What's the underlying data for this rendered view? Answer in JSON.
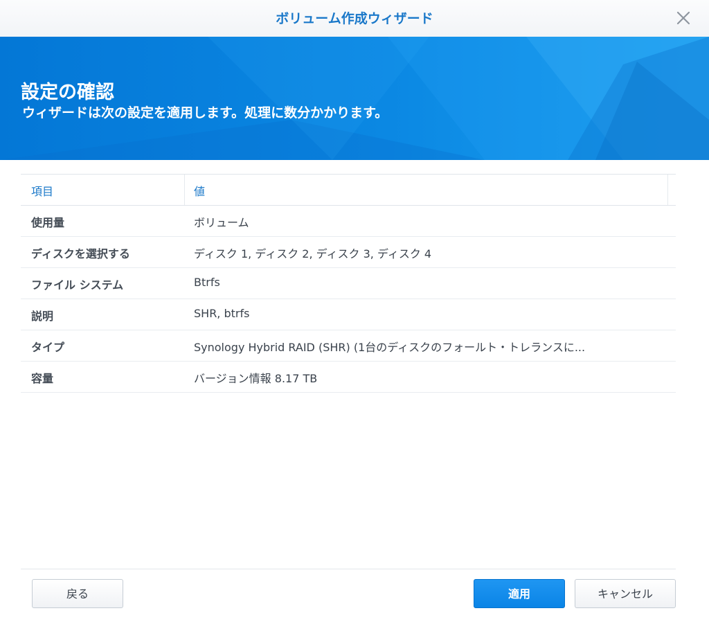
{
  "window": {
    "title": "ボリューム作成ウィザード"
  },
  "banner": {
    "title": "設定の確認",
    "subtitle": "ウィザードは次の設定を適用します。処理に数分かかります。"
  },
  "table": {
    "columns": [
      "項目",
      "値"
    ],
    "rows": [
      {
        "item": "使用量",
        "value": "ボリューム"
      },
      {
        "item": "ディスクを選択する",
        "value": "ディスク 1, ディスク 2, ディスク 3, ディスク 4"
      },
      {
        "item": "ファイル システム",
        "value": "Btrfs"
      },
      {
        "item": "説明",
        "value": "SHR, btrfs"
      },
      {
        "item": "タイプ",
        "value": "Synology Hybrid RAID (SHR) (1台のディスクのフォールト・トレランスに..."
      },
      {
        "item": "容量",
        "value": "バージョン情報 8.17 TB"
      }
    ]
  },
  "footer": {
    "back_label": "戻る",
    "apply_label": "適用",
    "cancel_label": "キャンセル"
  },
  "icons": {
    "close": "close-icon"
  },
  "colors": {
    "accent": "#1a78c9",
    "banner": "#0b88e3",
    "primary_button": "#0a84e6"
  }
}
